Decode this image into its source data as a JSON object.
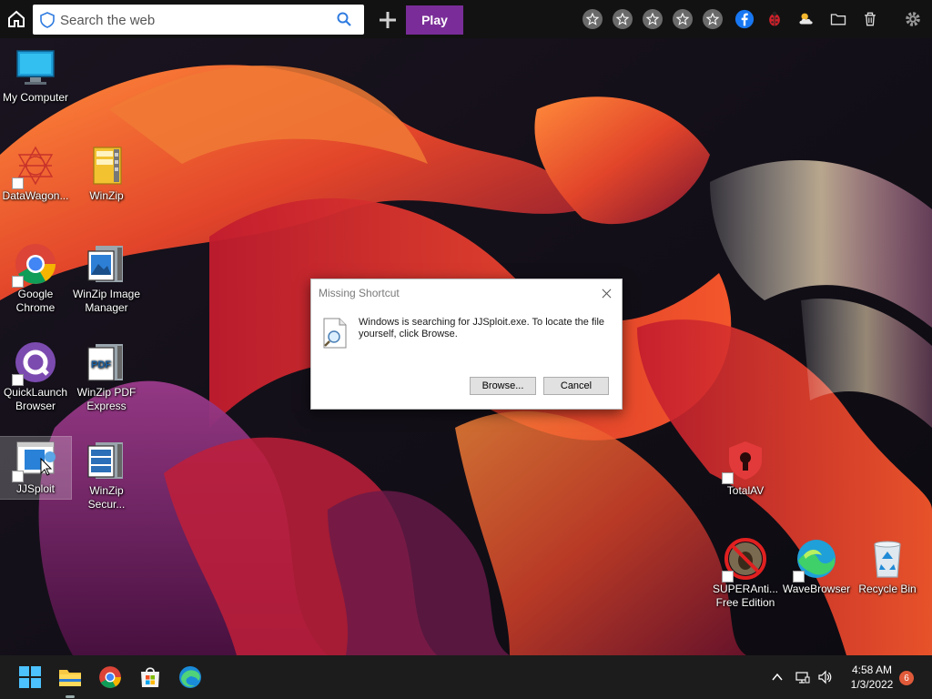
{
  "toolbar": {
    "search_placeholder": "Search the web",
    "play_label": "Play",
    "favorites": [
      "star-icon",
      "star-icon",
      "star-icon",
      "star-icon",
      "star-icon"
    ],
    "accent": "#7a2d98"
  },
  "desktop": {
    "icons": [
      {
        "name": "my-computer",
        "label": "My Computer"
      },
      {
        "name": "datawagon",
        "label": "DataWagon..."
      },
      {
        "name": "winzip",
        "label": "WinZip"
      },
      {
        "name": "google-chrome",
        "label": "Google Chrome"
      },
      {
        "name": "winzip-image-manager",
        "label": "WinZip Image Manager"
      },
      {
        "name": "quicklaunch-browser",
        "label": "QuickLaunch Browser"
      },
      {
        "name": "winzip-pdf-express",
        "label": "WinZip PDF Express"
      },
      {
        "name": "jjsploit",
        "label": "JJSploit"
      },
      {
        "name": "winzip-secure",
        "label": "WinZip Secur..."
      },
      {
        "name": "totalav",
        "label": "TotalAV"
      },
      {
        "name": "superantispyware",
        "label": "SUPERAnti... Free Edition"
      },
      {
        "name": "wavebrowser",
        "label": "WaveBrowser"
      },
      {
        "name": "recycle-bin",
        "label": "Recycle Bin"
      }
    ]
  },
  "dialog": {
    "title": "Missing Shortcut",
    "message": "Windows is searching for JJSploit.exe. To locate the file yourself, click Browse.",
    "browse_label": "Browse...",
    "cancel_label": "Cancel"
  },
  "taskbar": {
    "time": "4:58 AM",
    "date": "1/3/2022",
    "notification_count": "6"
  }
}
